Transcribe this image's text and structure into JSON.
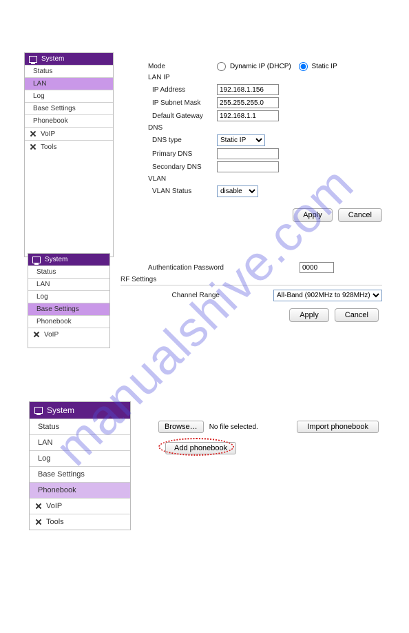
{
  "watermark": "manualshive.com",
  "sidebar": {
    "header": "System",
    "items": [
      "Status",
      "LAN",
      "Log",
      "Base Settings",
      "Phonebook"
    ],
    "cat_voip": "VoIP",
    "cat_tools": "Tools"
  },
  "section1": {
    "mode_label": "Mode",
    "mode_dhcp": "Dynamic IP (DHCP)",
    "mode_static": "Static IP",
    "lanip_title": "LAN IP",
    "ip_address_label": "IP Address",
    "ip_address_value": "192.168.1.156",
    "subnet_label": "IP Subnet Mask",
    "subnet_value": "255.255.255.0",
    "gateway_label": "Default Gateway",
    "gateway_value": "192.168.1.1",
    "dns_title": "DNS",
    "dns_type_label": "DNS type",
    "dns_type_value": "Static IP",
    "primary_dns_label": "Primary DNS",
    "primary_dns_value": "",
    "secondary_dns_label": "Secondary DNS",
    "secondary_dns_value": "",
    "vlan_title": "VLAN",
    "vlan_status_label": "VLAN Status",
    "vlan_status_value": "disable",
    "apply": "Apply",
    "cancel": "Cancel"
  },
  "section2": {
    "auth_label": "Authentication Password",
    "auth_value": "0000",
    "rf_title": "RF Settings",
    "channel_label": "Channel Range",
    "channel_value": "All-Band (902MHz to 928MHz)",
    "apply": "Apply",
    "cancel": "Cancel"
  },
  "section3": {
    "browse": "Browse…",
    "no_file": "No file selected.",
    "import": "Import phonebook",
    "add": "Add phonebook"
  }
}
